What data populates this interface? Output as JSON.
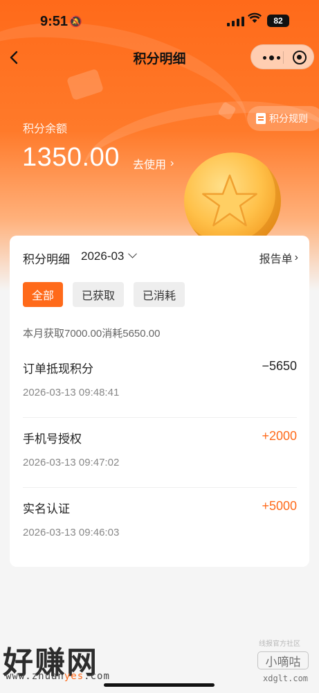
{
  "status_bar": {
    "time": "9:51",
    "battery": "82"
  },
  "nav": {
    "title": "积分明细"
  },
  "header": {
    "rules_label": "积分规则",
    "balance_label": "积分余额",
    "balance_value": "1350.00",
    "use_label": "去使用",
    "use_chevron": "›"
  },
  "card": {
    "title": "积分明细",
    "month": "2026-03",
    "report_label": "报告单",
    "report_chevron": "›",
    "filters": [
      {
        "label": "全部",
        "active": true
      },
      {
        "label": "已获取",
        "active": false
      },
      {
        "label": "已消耗",
        "active": false
      }
    ],
    "summary": "本月获取7000.00消耗5650.00",
    "records": [
      {
        "name": "订单抵现积分",
        "points": "−5650",
        "time": "2026-03-13 09:48:41"
      },
      {
        "name": "手机号授权",
        "points": "+2000",
        "time": "2026-03-13 09:47:02"
      },
      {
        "name": "实名认证",
        "points": "+5000",
        "time": "2026-03-13 09:46:03"
      }
    ]
  },
  "watermark": {
    "left_text": "好赚网",
    "left_url_a": "www.zhuan",
    "left_url_b": "yes",
    "left_url_c": ".com",
    "right_small": "线报官方社区",
    "right_text": "小嘀咕",
    "right_url": "xdglt.com"
  },
  "colors": {
    "accent": "#ff6a1a",
    "coin": "#ffc14a"
  }
}
